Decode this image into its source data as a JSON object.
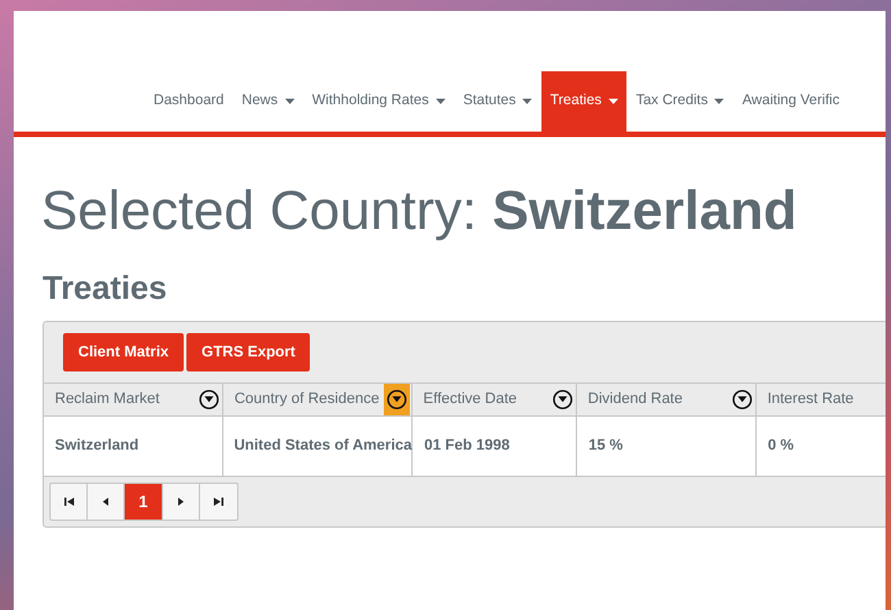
{
  "nav": {
    "items": [
      {
        "label": "Dashboard",
        "dropdown": false,
        "selected": false
      },
      {
        "label": "News",
        "dropdown": true,
        "selected": false
      },
      {
        "label": "Withholding Rates",
        "dropdown": true,
        "selected": false
      },
      {
        "label": "Statutes",
        "dropdown": true,
        "selected": false
      },
      {
        "label": "Treaties",
        "dropdown": true,
        "selected": true
      },
      {
        "label": "Tax Credits",
        "dropdown": true,
        "selected": false
      },
      {
        "label": "Awaiting Verific",
        "dropdown": false,
        "selected": false
      }
    ]
  },
  "heading": {
    "prefix": "Selected Country:",
    "country": "Switzerland"
  },
  "section_title": "Treaties",
  "toolbar": {
    "buttons": [
      "Client Matrix",
      "GTRS Export"
    ]
  },
  "table": {
    "columns": [
      {
        "label": "Reclaim Market",
        "filtered": false
      },
      {
        "label": "Country of Residence",
        "filtered": true
      },
      {
        "label": "Effective Date",
        "filtered": false
      },
      {
        "label": "Dividend Rate",
        "filtered": false
      },
      {
        "label": "Interest Rate"
      }
    ],
    "rows": [
      [
        "Switzerland",
        "United States of America",
        "01 Feb 1998",
        "15 %",
        "0 %"
      ]
    ]
  },
  "pager": {
    "items": [
      {
        "kind": "first"
      },
      {
        "kind": "prev"
      },
      {
        "kind": "page",
        "label": "1",
        "selected": true
      },
      {
        "kind": "next"
      },
      {
        "kind": "last"
      }
    ]
  }
}
